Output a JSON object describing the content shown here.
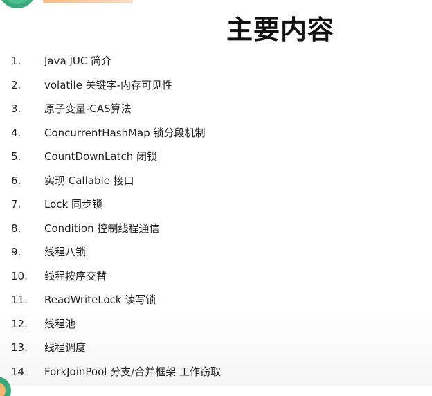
{
  "slide": {
    "title": "主要内容",
    "items": [
      {
        "num": "1.",
        "text": "Java JUC 简介"
      },
      {
        "num": "2.",
        "text": "volatile 关键字-内存可见性"
      },
      {
        "num": "3.",
        "text": "原子变量-CAS算法"
      },
      {
        "num": "4.",
        "text": "ConcurrentHashMap 锁分段机制"
      },
      {
        "num": "5.",
        "text": "CountDownLatch 闭锁"
      },
      {
        "num": "6.",
        "text": "实现 Callable 接口"
      },
      {
        "num": "7.",
        "text": "Lock 同步锁"
      },
      {
        "num": "8.",
        "text": "Condition 控制线程通信"
      },
      {
        "num": "9.",
        "text": "线程八锁"
      },
      {
        "num": "10.",
        "text": "线程按序交替"
      },
      {
        "num": "11.",
        "text": "ReadWriteLock 读写锁"
      },
      {
        "num": "12.",
        "text": "线程池"
      },
      {
        "num": "13.",
        "text": "线程调度"
      },
      {
        "num": "14.",
        "text": "ForkJoinPool 分支/合并框架 工作窃取"
      }
    ]
  },
  "colors": {
    "logo_green": "#3aa87a",
    "logo_orange": "#f0b27a",
    "text": "#1f1f1f"
  },
  "icons": {
    "logo": "brand-logo-icon",
    "corner": "corner-accent-icon"
  }
}
